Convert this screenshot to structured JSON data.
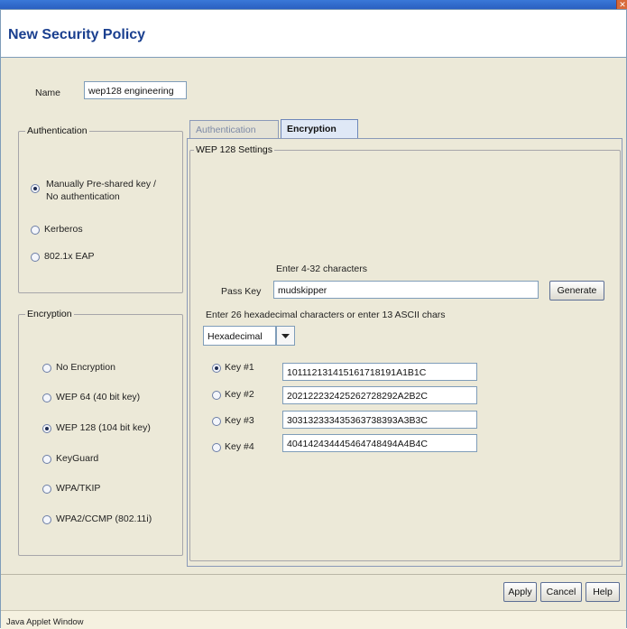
{
  "window": {
    "title": "New Security Policy",
    "close_icon": "✕"
  },
  "name_field": {
    "label": "Name",
    "value": "wep128 engineering"
  },
  "authentication_group": {
    "title": "Authentication",
    "options": [
      {
        "label_line1": "Manually Pre-shared key /",
        "label_line2": "No authentication",
        "selected": true
      },
      {
        "label": "Kerberos",
        "selected": false
      },
      {
        "label": "802.1x EAP",
        "selected": false
      }
    ]
  },
  "encryption_group": {
    "title": "Encryption",
    "options": [
      {
        "label": "No Encryption",
        "selected": false
      },
      {
        "label": "WEP 64 (40 bit key)",
        "selected": false
      },
      {
        "label": "WEP 128 (104 bit key)",
        "selected": true
      },
      {
        "label": "KeyGuard",
        "selected": false
      },
      {
        "label": "WPA/TKIP",
        "selected": false
      },
      {
        "label": "WPA2/CCMP (802.11i)",
        "selected": false
      }
    ]
  },
  "tabs": [
    {
      "label": "Authentication",
      "active": false
    },
    {
      "label": "Encryption",
      "active": true
    }
  ],
  "wep_settings": {
    "title": "WEP 128 Settings",
    "pass_key_hint": "Enter 4-32 characters",
    "pass_key_label": "Pass Key",
    "pass_key_value": "mudskipper",
    "generate_label": "Generate",
    "key_format_hint": "Enter 26 hexadecimal characters or enter 13 ASCII chars",
    "format_value": "Hexadecimal",
    "keys": [
      {
        "label": "Key #1",
        "value": "101112131415161718191A1B1C",
        "selected": true
      },
      {
        "label": "Key #2",
        "value": "202122232425262728292A2B2C",
        "selected": false
      },
      {
        "label": "Key #3",
        "value": "303132333435363738393A3B3C",
        "selected": false
      },
      {
        "label": "Key #4",
        "value": "404142434445464748494A4B4C",
        "selected": false
      }
    ]
  },
  "buttons": {
    "apply": "Apply",
    "cancel": "Cancel",
    "help": "Help"
  },
  "status_bar": {
    "text": "Java Applet Window"
  },
  "colors": {
    "title": "#1a3f8f",
    "window_bg": "#ece9d8",
    "titlebar": "#2a5fc0"
  }
}
